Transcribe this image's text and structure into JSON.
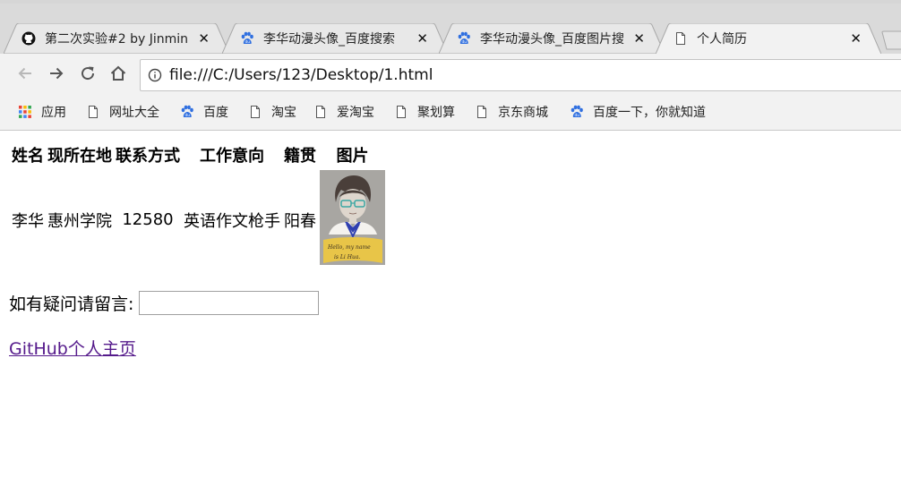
{
  "tabs": [
    {
      "title": "第二次实验#2 by Jinmin",
      "icon": "github-icon"
    },
    {
      "title": "李华动漫头像_百度搜索",
      "icon": "baidu-paw-icon"
    },
    {
      "title": "李华动漫头像_百度图片搜",
      "icon": "baidu-paw-icon"
    },
    {
      "title": "个人简历",
      "icon": "page-icon",
      "active": true
    }
  ],
  "toolbar": {
    "url": "file:///C:/Users/123/Desktop/1.html"
  },
  "bookmarks": [
    {
      "label": "应用",
      "icon": "apps-grid-icon"
    },
    {
      "label": "网址大全",
      "icon": "page-icon"
    },
    {
      "label": "百度",
      "icon": "baidu-paw-icon"
    },
    {
      "label": "淘宝",
      "icon": "page-icon"
    },
    {
      "label": "爱淘宝",
      "icon": "page-icon"
    },
    {
      "label": "聚划算",
      "icon": "page-icon"
    },
    {
      "label": "京东商城",
      "icon": "page-icon"
    },
    {
      "label": "百度一下，你就知道",
      "icon": "baidu-paw-icon"
    }
  ],
  "resume": {
    "headers": [
      "姓名",
      "现所在地",
      "联系方式",
      "工作意向",
      "籍贯",
      "图片"
    ],
    "row": [
      "李华",
      "惠州学院",
      "12580",
      "英语作文枪手",
      "阳春"
    ]
  },
  "form": {
    "label": "如有疑问请留言:",
    "value": ""
  },
  "link": {
    "text": "GitHub个人主页"
  },
  "avatar_note": {
    "line1": "Hello, my name",
    "line2": "is Li Hua."
  },
  "colors": {
    "tabstrip": "#dadada",
    "toolbar": "#f2f2f2",
    "visited_link": "#551a8b"
  }
}
